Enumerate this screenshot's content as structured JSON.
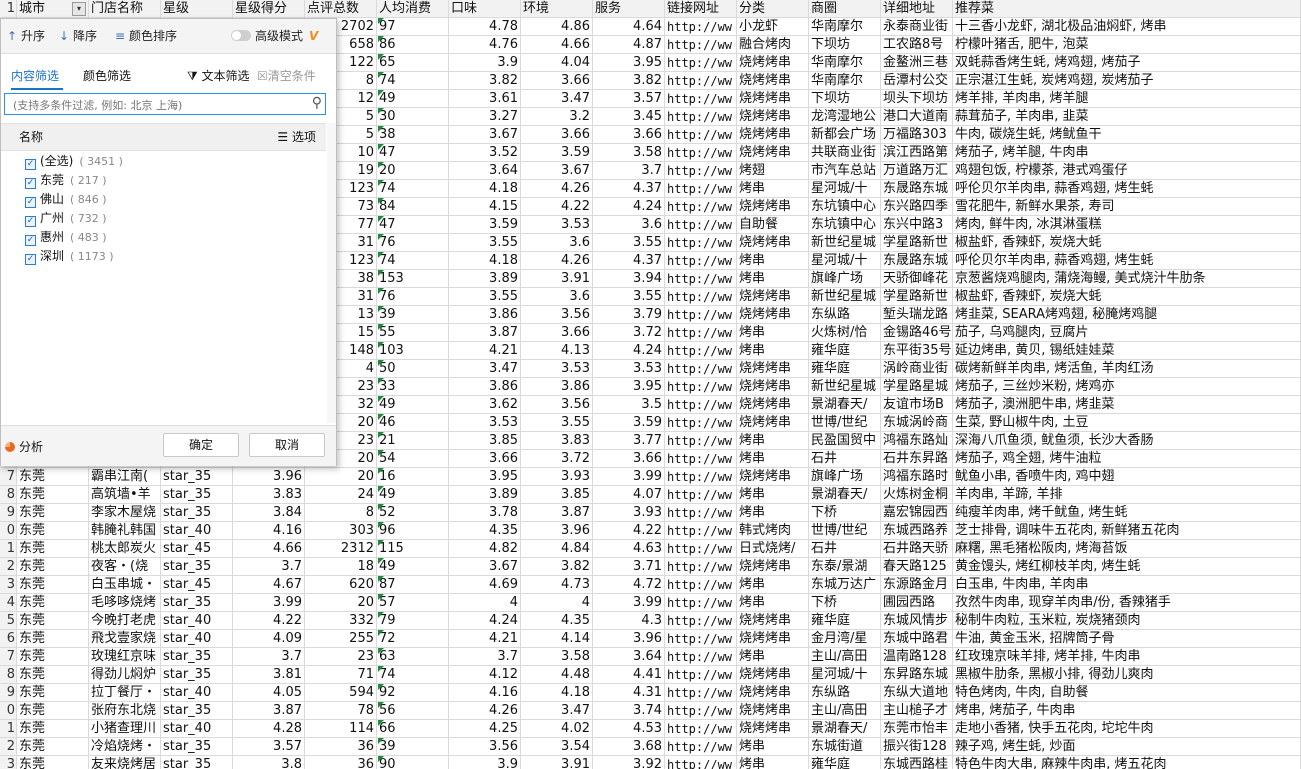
{
  "header": {
    "row_num": "1",
    "cells": [
      "城市",
      "门店名称",
      "星级",
      "星级得分",
      "点评总数",
      "人均消费",
      "口味",
      "环境",
      "服务",
      "链接网址",
      "分类",
      "商圈",
      "详细地址",
      "推荐菜"
    ]
  },
  "rows": [
    {
      "n": "",
      "c": [
        "",
        "",
        "",
        "",
        "2702",
        "97",
        "4.78",
        "4.86",
        "4.64",
        "http://ww",
        "小龙虾",
        "华南摩尔",
        "永泰商业街",
        "十三香小龙虾, 湖北极品油焖虾, 烤串"
      ]
    },
    {
      "n": "",
      "c": [
        "",
        "",
        "",
        "",
        "658",
        "86",
        "4.76",
        "4.66",
        "4.87",
        "http://ww",
        "融合烤肉",
        "下坝坊",
        "工农路8号",
        "柠檬叶猪舌, 肥牛, 泡菜"
      ]
    },
    {
      "n": "",
      "c": [
        "",
        "",
        "",
        "",
        "122",
        "65",
        "3.9",
        "4.04",
        "3.95",
        "http://ww",
        "烧烤烤串",
        "华南摩尔",
        "金鳌洲三巷",
        "双蚝蒜香烤生蚝, 烤鸡翅, 烤茄子"
      ]
    },
    {
      "n": "",
      "c": [
        "",
        "",
        "",
        "",
        "8",
        "74",
        "3.82",
        "3.66",
        "3.82",
        "http://ww",
        "烧烤烤串",
        "华南摩尔",
        "岳潭村公交",
        "正宗湛江生蚝, 炭烤鸡翅, 炭烤茄子"
      ]
    },
    {
      "n": "",
      "c": [
        "",
        "",
        "",
        "",
        "12",
        "49",
        "3.61",
        "3.47",
        "3.57",
        "http://ww",
        "烧烤烤串",
        "下坝坊",
        "坝头下坝坊",
        "烤羊排, 羊肉串, 烤羊腿"
      ]
    },
    {
      "n": "",
      "c": [
        "",
        "",
        "",
        "",
        "5",
        "30",
        "3.27",
        "3.2",
        "3.45",
        "http://ww",
        "烧烤烤串",
        "龙湾湿地公",
        "港口大道南",
        "蒜茸茄子, 羊肉串, 韭菜"
      ]
    },
    {
      "n": "",
      "c": [
        "",
        "",
        "",
        "",
        "5",
        "38",
        "3.67",
        "3.66",
        "3.66",
        "http://ww",
        "烧烤烤串",
        "新都会广场",
        "万福路303",
        "牛肉, 碳烧生蚝, 烤鱿鱼干"
      ]
    },
    {
      "n": "",
      "c": [
        "",
        "",
        "",
        "",
        "10",
        "47",
        "3.52",
        "3.59",
        "3.58",
        "http://ww",
        "烧烤烤串",
        "共联商业街",
        "滨江西路第",
        "烤茄子, 烤羊腿, 牛肉串"
      ]
    },
    {
      "n": "",
      "c": [
        "",
        "",
        "",
        "",
        "19",
        "20",
        "3.64",
        "3.67",
        "3.7",
        "http://ww",
        "烤翅",
        "市汽车总站",
        "万道路万汇",
        "鸡翅包饭, 柠檬茶, 港式鸡蛋仔"
      ]
    },
    {
      "n": "",
      "c": [
        "",
        "",
        "",
        "",
        "123",
        "74",
        "4.18",
        "4.26",
        "4.37",
        "http://ww",
        "烤串",
        "星河城/十",
        "东晟路东城",
        "呼伦贝尔羊肉串, 蒜香鸡翅, 烤生蚝"
      ]
    },
    {
      "n": "",
      "c": [
        "",
        "",
        "",
        "",
        "73",
        "84",
        "4.15",
        "4.22",
        "4.24",
        "http://ww",
        "烧烤烤串",
        "东坑镇中心",
        "东兴路四季",
        "雪花肥牛, 新鲜水果茶, 寿司"
      ]
    },
    {
      "n": "",
      "c": [
        "",
        "",
        "",
        "",
        "77",
        "47",
        "3.59",
        "3.53",
        "3.6",
        "http://ww",
        "自助餐",
        "东坑镇中心",
        "东兴中路3",
        "烤肉, 鲜牛肉, 冰淇淋蛋糕"
      ]
    },
    {
      "n": "",
      "c": [
        "",
        "",
        "",
        "",
        "31",
        "76",
        "3.55",
        "3.6",
        "3.55",
        "http://ww",
        "烧烤烤串",
        "新世纪星城",
        "学星路新世",
        "椒盐虾, 香辣虾, 炭烧大蚝"
      ]
    },
    {
      "n": "",
      "c": [
        "",
        "",
        "",
        "",
        "123",
        "74",
        "4.18",
        "4.26",
        "4.37",
        "http://ww",
        "烤串",
        "星河城/十",
        "东晟路东城",
        "呼伦贝尔羊肉串, 蒜香鸡翅, 烤生蚝"
      ]
    },
    {
      "n": "",
      "c": [
        "",
        "",
        "",
        "",
        "38",
        "153",
        "3.89",
        "3.91",
        "3.94",
        "http://ww",
        "烤串",
        "旗峰广场",
        "天骄御峰花",
        "京葱酱烧鸡腿肉, 蒲烧海鳗, 美式烧汁牛肋条"
      ]
    },
    {
      "n": "",
      "c": [
        "",
        "",
        "",
        "",
        "31",
        "76",
        "3.55",
        "3.6",
        "3.55",
        "http://ww",
        "烧烤烤串",
        "新世纪星城",
        "学星路新世",
        "椒盐虾, 香辣虾, 炭烧大蚝"
      ]
    },
    {
      "n": "",
      "c": [
        "",
        "",
        "",
        "",
        "13",
        "39",
        "3.86",
        "3.56",
        "3.79",
        "http://ww",
        "烧烤烤串",
        "东纵路",
        "堑头瑞龙路",
        "烤韭菜, SEARA烤鸡翅, 秘腌烤鸡腿"
      ]
    },
    {
      "n": "",
      "c": [
        "",
        "",
        "",
        "",
        "15",
        "55",
        "3.87",
        "3.66",
        "3.72",
        "http://ww",
        "烤串",
        "火炼树/恰",
        "金锡路46号",
        "茄子, 乌鸡腿肉, 豆腐片"
      ]
    },
    {
      "n": "",
      "c": [
        "",
        "",
        "",
        "",
        "148",
        "103",
        "4.21",
        "4.13",
        "4.24",
        "http://ww",
        "烤串",
        "雍华庭",
        "东平街35号",
        "延边烤串, 黄贝, 锡纸娃娃菜"
      ]
    },
    {
      "n": "",
      "c": [
        "",
        "",
        "",
        "",
        "4",
        "50",
        "3.47",
        "3.53",
        "3.53",
        "http://ww",
        "烧烤烤串",
        "雍华庭",
        "涡岭商业街",
        "碳烤新鲜羊肉串, 烤活鱼, 羊肉红汤"
      ]
    },
    {
      "n": "",
      "c": [
        "",
        "",
        "",
        "",
        "23",
        "33",
        "3.86",
        "3.86",
        "3.95",
        "http://ww",
        "烧烤烤串",
        "新世纪星城",
        "学星路星城",
        "烤茄子, 三丝炒米粉, 烤鸡亦"
      ]
    },
    {
      "n": "",
      "c": [
        "",
        "",
        "",
        "",
        "32",
        "49",
        "3.62",
        "3.56",
        "3.5",
        "http://ww",
        "烧烤烤串",
        "景湖春天/",
        "友谊市场B",
        "烤茄子, 澳洲肥牛串, 烤韭菜"
      ]
    },
    {
      "n": "",
      "c": [
        "",
        "",
        "",
        "",
        "20",
        "46",
        "3.53",
        "3.55",
        "3.59",
        "http://ww",
        "烧烤烤串",
        "世博/世纪",
        "东城涡岭商",
        "生菜, 野山椒牛肉, 土豆"
      ]
    },
    {
      "n": "",
      "c": [
        "",
        "",
        "",
        "",
        "23",
        "21",
        "3.85",
        "3.83",
        "3.77",
        "http://ww",
        "烤串",
        "民盈国贸中",
        "鸿福东路灿",
        "深海八爪鱼须, 鱿鱼须, 长沙大香肠"
      ]
    },
    {
      "n": "",
      "c": [
        "",
        "",
        "",
        "",
        "20",
        "54",
        "3.66",
        "3.72",
        "3.66",
        "http://ww",
        "烤串",
        "石井",
        "石井东昇路",
        "烤茄子, 鸡全翅, 烤牛油粒"
      ]
    },
    {
      "n": "7",
      "c": [
        "东莞",
        "霸串江南(",
        "star_35",
        "3.96",
        "20",
        "16",
        "3.95",
        "3.93",
        "3.99",
        "http://ww",
        "烧烤烤串",
        "旗峰广场",
        "鸿福东路时",
        "鱿鱼小串, 香喷牛肉, 鸡中翅"
      ]
    },
    {
      "n": "8",
      "c": [
        "东莞",
        "高筑墙•羊",
        "star_35",
        "3.83",
        "24",
        "49",
        "3.89",
        "3.85",
        "4.07",
        "http://ww",
        "烤串",
        "景湖春天/",
        "火炼树金桐",
        "羊肉串, 羊蹄, 羊排"
      ]
    },
    {
      "n": "9",
      "c": [
        "东莞",
        "李家木屋烧",
        "star_35",
        "3.84",
        "8",
        "52",
        "3.78",
        "3.87",
        "3.93",
        "http://ww",
        "烤串",
        "下桥",
        "嘉宏锦园西",
        "纯瘦羊肉串, 烤千鱿鱼, 烤生蚝"
      ]
    },
    {
      "n": "0",
      "c": [
        "东莞",
        "韩腌礼韩国",
        "star_40",
        "4.16",
        "303",
        "96",
        "4.35",
        "3.96",
        "4.22",
        "http://ww",
        "韩式烤肉",
        "世博/世纪",
        "东城西路养",
        "芝士排骨, 调味牛五花肉, 新鲜猪五花肉"
      ]
    },
    {
      "n": "1",
      "c": [
        "东莞",
        "桃太郎炭火",
        "star_45",
        "4.66",
        "2312",
        "115",
        "4.82",
        "4.84",
        "4.63",
        "http://ww",
        "日式烧烤/",
        "石井",
        "石井路天骄",
        "麻糬, 黑毛猪松阪肉, 烤海苔饭"
      ]
    },
    {
      "n": "2",
      "c": [
        "东莞",
        "夜客・(烧",
        "star_35",
        "3.7",
        "18",
        "49",
        "3.67",
        "3.82",
        "3.71",
        "http://ww",
        "烧烤烤串",
        "东泰/景湖",
        "春天路125",
        "黄金馒头, 烤红柳枝羊肉, 烤生蚝"
      ]
    },
    {
      "n": "3",
      "c": [
        "东莞",
        "白玉串城・",
        "star_45",
        "4.67",
        "620",
        "87",
        "4.69",
        "4.73",
        "4.72",
        "http://ww",
        "烤串",
        "东城万达广",
        "东源路金月",
        "白玉串, 牛肉串, 羊肉串"
      ]
    },
    {
      "n": "4",
      "c": [
        "东莞",
        "毛哆哆烧烤",
        "star_35",
        "3.99",
        "20",
        "57",
        "4",
        "4",
        "3.99",
        "http://ww",
        "烤串",
        "下桥",
        "圃园西路",
        "孜然牛肉串, 现穿羊肉串/份, 香辣猪手"
      ]
    },
    {
      "n": "5",
      "c": [
        "东莞",
        "今晚打老虎",
        "star_40",
        "4.22",
        "332",
        "79",
        "4.24",
        "4.35",
        "4.3",
        "http://ww",
        "烧烤烤串",
        "雍华庭",
        "东城风情步",
        "秘制牛肉粒, 玉米粒, 炭烧猪颈肉"
      ]
    },
    {
      "n": "6",
      "c": [
        "东莞",
        "飛戈壹家烧",
        "star_40",
        "4.09",
        "255",
        "72",
        "4.21",
        "4.14",
        "3.96",
        "http://ww",
        "烧烤烤串",
        "金月湾/星",
        "东城中路君",
        "牛油, 黄金玉米, 招牌筒子骨"
      ]
    },
    {
      "n": "7",
      "c": [
        "东莞",
        "玫瑰红京味",
        "star_35",
        "3.7",
        "23",
        "63",
        "3.7",
        "3.58",
        "3.64",
        "http://ww",
        "烤串",
        "主山/高田",
        "温南路128",
        "红玫瑰京味羊排, 烤羊排, 牛肉串"
      ]
    },
    {
      "n": "8",
      "c": [
        "东莞",
        "得劲儿焖炉",
        "star_35",
        "3.81",
        "71",
        "74",
        "4.12",
        "4.48",
        "4.41",
        "http://ww",
        "烧烤烤串",
        "星河城/十",
        "东昇路东城",
        "黑椒牛肋条, 黑椒小排, 得劲儿爽肉"
      ]
    },
    {
      "n": "9",
      "c": [
        "东莞",
        "拉丁餐厅・",
        "star_40",
        "4.05",
        "594",
        "92",
        "4.16",
        "4.18",
        "4.31",
        "http://ww",
        "烧烤烤串",
        "东纵路",
        "东纵大道地",
        "特色烤肉, 牛肉, 自助餐"
      ]
    },
    {
      "n": "0",
      "c": [
        "东莞",
        "张府东北烧",
        "star_35",
        "3.87",
        "78",
        "56",
        "4.26",
        "3.47",
        "3.74",
        "http://ww",
        "烧烤烤串",
        "主山/高田",
        "主山槌子才",
        "烤串, 烤茄子, 牛肉串"
      ]
    },
    {
      "n": "1",
      "c": [
        "东莞",
        "小猪查理川",
        "star_40",
        "4.28",
        "114",
        "66",
        "4.25",
        "4.02",
        "4.53",
        "http://ww",
        "烧烤烤串",
        "景湖春天/",
        "东莞市怡丰",
        "走地小香猪, 快手五花肉, 坨坨牛肉"
      ]
    },
    {
      "n": "2",
      "c": [
        "东莞",
        "冷焰烧烤・",
        "star_35",
        "3.57",
        "36",
        "39",
        "3.56",
        "3.54",
        "3.68",
        "http://ww",
        "烤串",
        "东城街道",
        "振兴街128",
        "辣子鸡, 烤生蚝, 炒面"
      ]
    },
    {
      "n": "3",
      "c": [
        "东莞",
        "友来烧烤居",
        "star_35",
        "3.8",
        "36",
        "90",
        "3.9",
        "3.91",
        "3.92",
        "http://ww",
        "烤串",
        "雍华庭",
        "东城西路桂",
        "特色牛肉大串, 麻辣牛肉串, 烤五花肉"
      ]
    }
  ],
  "panel": {
    "toolbar": {
      "asc": "升序",
      "desc": "降序",
      "color_sort": "颜色排序",
      "advanced": "高级模式",
      "advanced_badge": "V"
    },
    "tabs": {
      "content": "内容筛选",
      "color": "颜色筛选",
      "text_filter": "文本筛选",
      "clear": "清空条件"
    },
    "search": {
      "placeholder": "(支持多条件过滤, 例如: 北京 上海)"
    },
    "list": {
      "header": "名称",
      "options": "选项",
      "items": [
        {
          "label": "(全选)",
          "count": "( 3451 )"
        },
        {
          "label": "东莞",
          "count": "( 217 )"
        },
        {
          "label": "佛山",
          "count": "( 846 )"
        },
        {
          "label": "广州",
          "count": "( 732 )"
        },
        {
          "label": "惠州",
          "count": "( 483 )"
        },
        {
          "label": "深圳",
          "count": "( 1173 )"
        }
      ]
    },
    "footer": {
      "analysis": "分析",
      "ok": "确定",
      "cancel": "取消"
    }
  },
  "colors": {
    "accent": "#1a73c9",
    "comment_marker": "#1e8b3c",
    "advanced_badge": "#f08c1a"
  }
}
